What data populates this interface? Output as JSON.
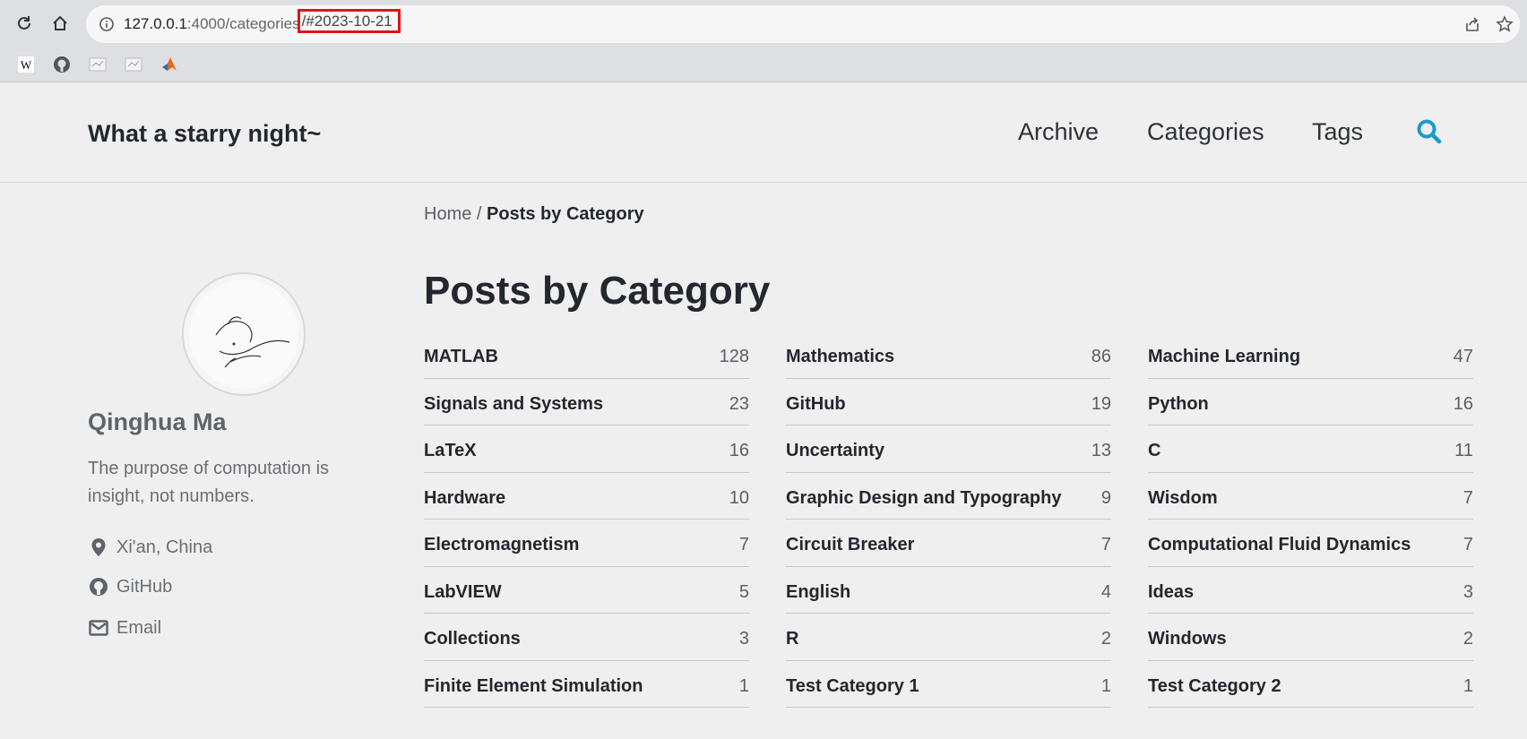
{
  "browser": {
    "url_host": "127.0.0.1",
    "url_path": ":4000/categories",
    "url_fragment": "/#2023-10-21",
    "bookmarks": [
      "wikipedia-icon",
      "github-icon",
      "page-icon",
      "page-icon",
      "matlab-icon"
    ]
  },
  "site": {
    "title": "What a starry night~",
    "nav": [
      "Archive",
      "Categories",
      "Tags"
    ]
  },
  "author": {
    "name": "Qinghua Ma",
    "bio": "The purpose of computation is insight, not numbers.",
    "location": "Xi'an, China",
    "github": "GitHub",
    "email": "Email"
  },
  "breadcrumb": {
    "home": "Home",
    "separator": " / ",
    "current": "Posts by Category"
  },
  "page_title": "Posts by Category",
  "categories": [
    [
      {
        "name": "MATLAB",
        "count": "128"
      },
      {
        "name": "Signals and Systems",
        "count": "23"
      },
      {
        "name": "LaTeX",
        "count": "16"
      },
      {
        "name": "Hardware",
        "count": "10"
      },
      {
        "name": "Electromagnetism",
        "count": "7"
      },
      {
        "name": "LabVIEW",
        "count": "5"
      },
      {
        "name": "Collections",
        "count": "3"
      },
      {
        "name": "Finite Element Simulation",
        "count": "1"
      }
    ],
    [
      {
        "name": "Mathematics",
        "count": "86"
      },
      {
        "name": "GitHub",
        "count": "19"
      },
      {
        "name": "Uncertainty",
        "count": "13"
      },
      {
        "name": "Graphic Design and Typography",
        "count": "9"
      },
      {
        "name": "Circuit Breaker",
        "count": "7"
      },
      {
        "name": "English",
        "count": "4"
      },
      {
        "name": "R",
        "count": "2"
      },
      {
        "name": "Test Category 1",
        "count": "1"
      }
    ],
    [
      {
        "name": "Machine Learning",
        "count": "47"
      },
      {
        "name": "Python",
        "count": "16"
      },
      {
        "name": "C",
        "count": "11"
      },
      {
        "name": "Wisdom",
        "count": "7"
      },
      {
        "name": "Computational Fluid Dynamics",
        "count": "7"
      },
      {
        "name": "Ideas",
        "count": "3"
      },
      {
        "name": "Windows",
        "count": "2"
      },
      {
        "name": "Test Category 2",
        "count": "1"
      }
    ]
  ],
  "colors": {
    "accent": "#1a9bcc",
    "highlight_box": "#e0141b"
  }
}
